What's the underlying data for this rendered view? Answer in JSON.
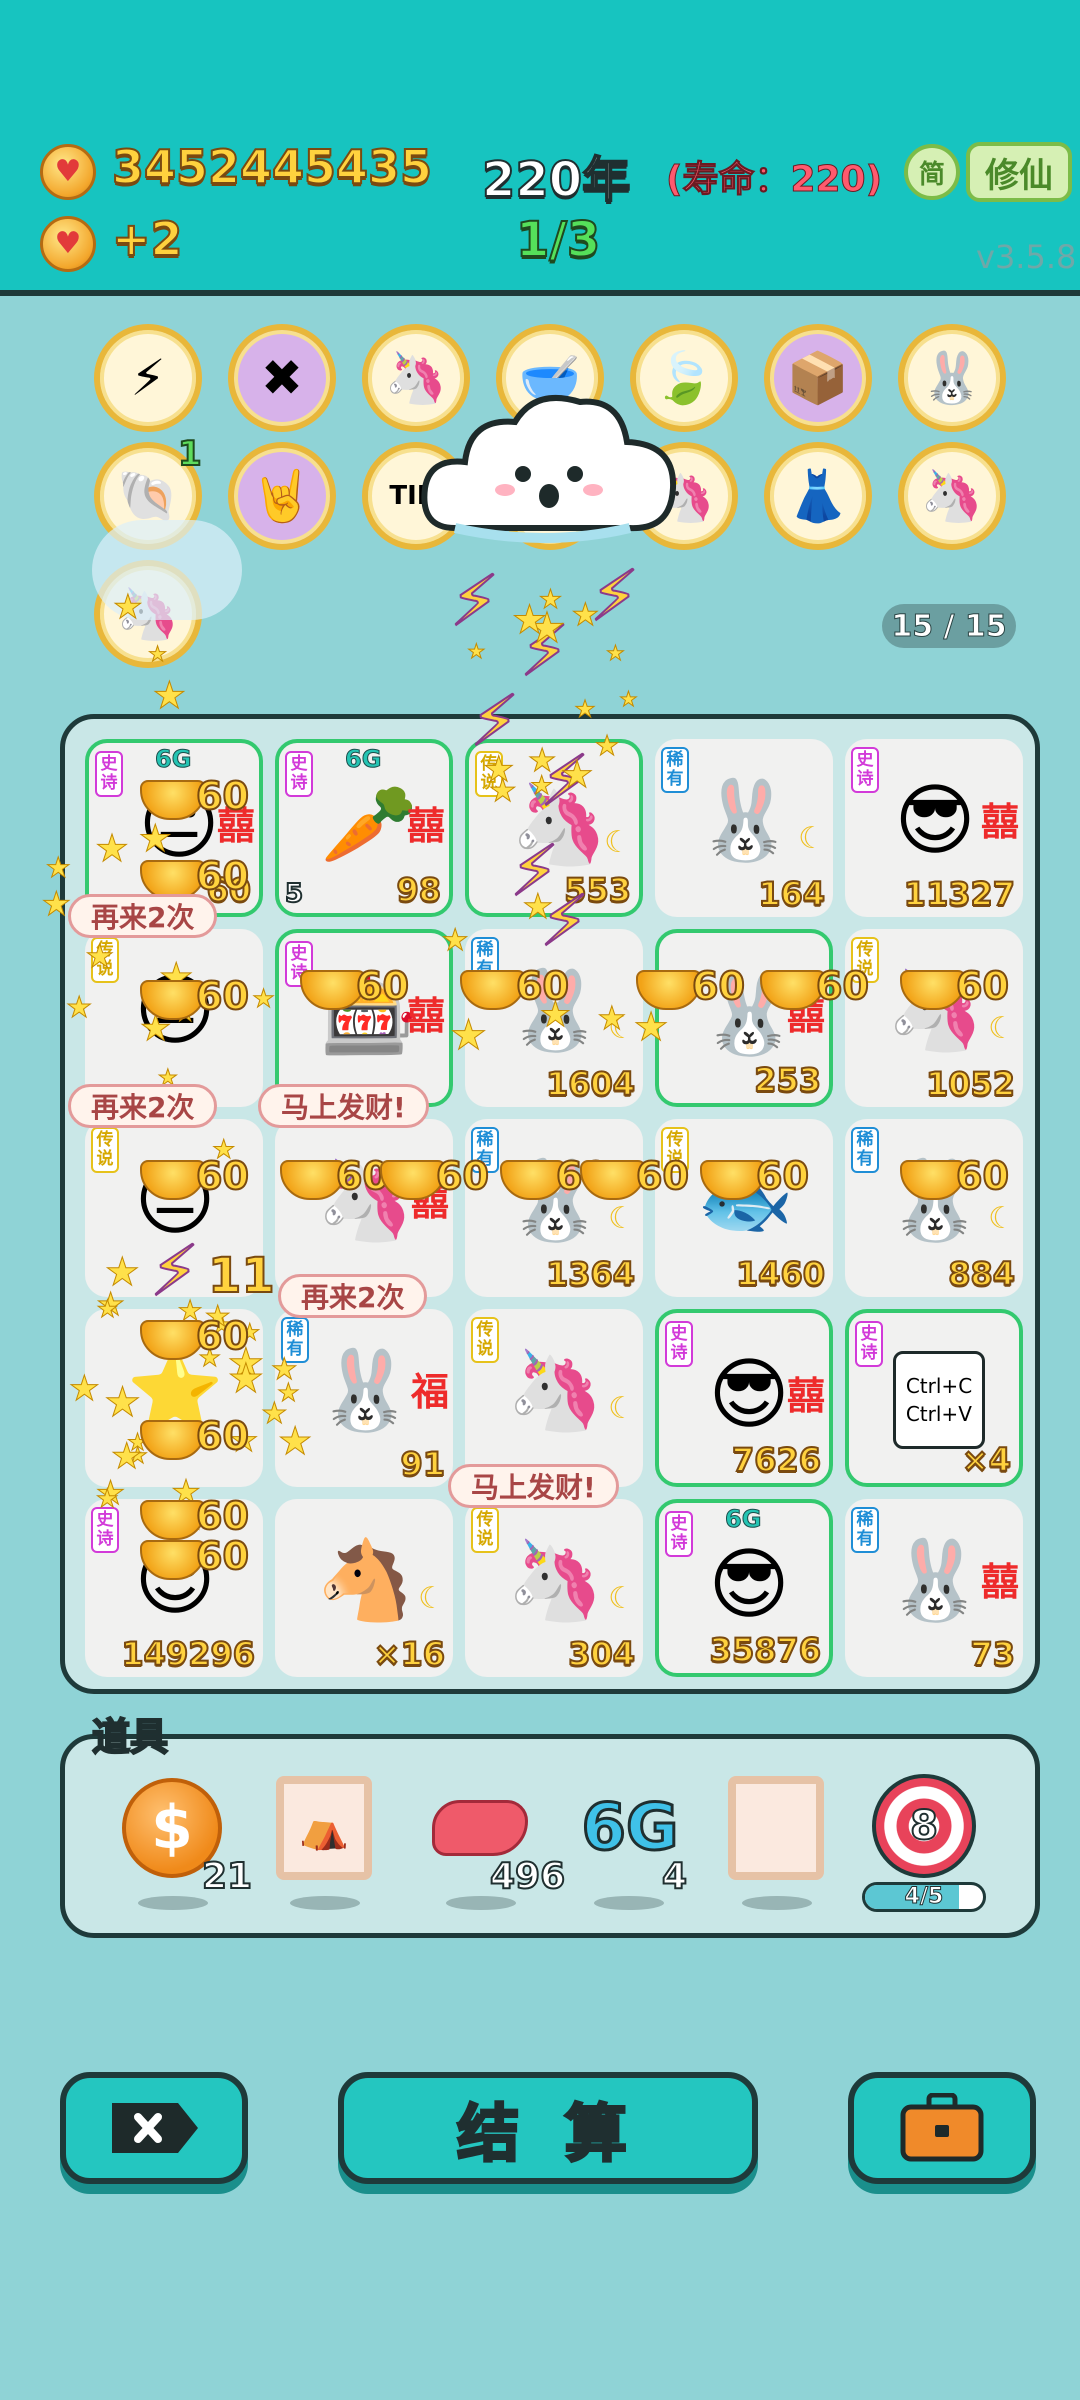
{
  "header": {
    "coins": "3452445435",
    "year": "220年",
    "lifespan": "(寿命：220)",
    "income": "+2",
    "round": "1/3",
    "simplified_label": "简",
    "cultivate_label": "修仙",
    "version": "v3.5.8"
  },
  "relics": {
    "count_badge": "1",
    "page_count": "15 / 15",
    "row1": [
      {
        "icon": "lightning-icon",
        "glyph": "⚡"
      },
      {
        "icon": "math-symbols-icon",
        "glyph": "✖"
      },
      {
        "icon": "unicorn-icon",
        "glyph": "🦄"
      },
      {
        "icon": "bowl-icon",
        "glyph": "🥣"
      },
      {
        "icon": "leaf-icon",
        "glyph": "🍃"
      },
      {
        "icon": "tissue-box-icon",
        "glyph": "📦"
      },
      {
        "icon": "rabbit-icon",
        "glyph": "🐰"
      }
    ],
    "row2": [
      {
        "icon": "shell-icon",
        "glyph": "🐚"
      },
      {
        "icon": "rock-hand-icon",
        "glyph": "🤘"
      },
      {
        "icon": "tim-card-icon",
        "glyph": "TIM"
      },
      {
        "icon": "cloud-icon",
        "glyph": "☁"
      },
      {
        "icon": "unicorn-icon",
        "glyph": "🦄"
      },
      {
        "icon": "skirt-icon",
        "glyph": "👗"
      },
      {
        "icon": "unicorn-icon",
        "glyph": "🦄"
      }
    ]
  },
  "board": {
    "cells": [
      {
        "rarity": "史诗",
        "rarity_color": "purple",
        "g6": "6G",
        "icon": "face-icon",
        "glyph": "😐",
        "xi": "囍",
        "value": "60",
        "left": "",
        "border": "green"
      },
      {
        "rarity": "史诗",
        "rarity_color": "purple",
        "g6": "6G",
        "icon": "carrot-icon",
        "glyph": "🥕",
        "xi": "囍",
        "value": "98",
        "left": "5",
        "border": "green"
      },
      {
        "rarity": "传说",
        "rarity_color": "yellow",
        "g6": "",
        "icon": "unicorn-icon",
        "glyph": "🦄",
        "xi": "",
        "value": "553",
        "left": "",
        "border": "green"
      },
      {
        "rarity": "稀有",
        "rarity_color": "blue",
        "g6": "",
        "icon": "rabbit-icon",
        "glyph": "🐰",
        "xi": "",
        "value": "164",
        "left": "",
        "border": ""
      },
      {
        "rarity": "史诗",
        "rarity_color": "purple",
        "g6": "",
        "icon": "cool-guy-icon",
        "glyph": "😎",
        "xi": "囍",
        "value": "11327",
        "left": "",
        "border": ""
      },
      {
        "rarity": "传说",
        "rarity_color": "yellow",
        "g6": "",
        "icon": "face-icon",
        "glyph": "😐",
        "xi": "",
        "value": "",
        "left": "",
        "border": ""
      },
      {
        "rarity": "史诗",
        "rarity_color": "purple",
        "g6": "",
        "icon": "vending-machine-icon",
        "glyph": "🎰",
        "xi": "囍",
        "value": "",
        "left": "",
        "border": "green"
      },
      {
        "rarity": "稀有",
        "rarity_color": "blue",
        "g6": "",
        "icon": "rabbit-icon",
        "glyph": "🐰",
        "xi": "",
        "value": "1604",
        "left": "",
        "border": ""
      },
      {
        "rarity": "",
        "rarity_color": "",
        "g6": "",
        "icon": "rabbit-icon",
        "glyph": "🐰",
        "xi": "囍",
        "value": "253",
        "left": "",
        "border": "green"
      },
      {
        "rarity": "传说",
        "rarity_color": "yellow",
        "g6": "",
        "icon": "unicorn-icon",
        "glyph": "🦄",
        "xi": "",
        "value": "1052",
        "left": "",
        "border": ""
      },
      {
        "rarity": "传说",
        "rarity_color": "yellow",
        "g6": "",
        "icon": "face-icon",
        "glyph": "😐",
        "xi": "",
        "value": "",
        "left": "",
        "border": ""
      },
      {
        "rarity": "",
        "rarity_color": "",
        "g6": "",
        "icon": "unicorn-icon",
        "glyph": "🦄",
        "xi": "囍",
        "value": "",
        "left": "",
        "border": ""
      },
      {
        "rarity": "稀有",
        "rarity_color": "blue",
        "g6": "",
        "icon": "rabbit-icon",
        "glyph": "🐰",
        "xi": "",
        "value": "1364",
        "left": "",
        "border": ""
      },
      {
        "rarity": "传说",
        "rarity_color": "yellow",
        "g6": "",
        "icon": "koi-fish-icon",
        "glyph": "🐟",
        "xi": "",
        "value": "1460",
        "left": "",
        "border": ""
      },
      {
        "rarity": "稀有",
        "rarity_color": "blue",
        "g6": "",
        "icon": "rabbit-icon",
        "glyph": "🐰",
        "xi": "",
        "value": "884",
        "left": "",
        "border": ""
      },
      {
        "rarity": "",
        "rarity_color": "",
        "g6": "",
        "icon": "star-pile-icon",
        "glyph": "⭐",
        "xi": "",
        "value": "",
        "left": "",
        "border": ""
      },
      {
        "rarity": "稀有",
        "rarity_color": "blue",
        "g6": "",
        "icon": "rabbit-icon",
        "glyph": "🐰",
        "xi": "福",
        "value": "91",
        "left": "",
        "border": ""
      },
      {
        "rarity": "传说",
        "rarity_color": "yellow",
        "g6": "",
        "icon": "unicorn-icon",
        "glyph": "🦄",
        "xi": "",
        "value": "",
        "left": "",
        "border": ""
      },
      {
        "rarity": "史诗",
        "rarity_color": "purple",
        "g6": "",
        "icon": "cool-guy-icon",
        "glyph": "😎",
        "xi": "囍",
        "value": "7626",
        "left": "",
        "border": "green"
      },
      {
        "rarity": "史诗",
        "rarity_color": "purple",
        "g6": "",
        "icon": "copy-paste-icon",
        "glyph": "Ctrl+C\nCtrl+V",
        "xi": "",
        "value": "×4",
        "left": "",
        "border": "green"
      },
      {
        "rarity": "史诗",
        "rarity_color": "purple",
        "g6": "",
        "icon": "cool-guy-icon",
        "glyph": "😎",
        "xi": "",
        "value": "149296",
        "left": "",
        "border": ""
      },
      {
        "rarity": "",
        "rarity_color": "",
        "g6": "",
        "icon": "horse-icon",
        "glyph": "🐴",
        "xi": "",
        "value": "×16",
        "left": "",
        "border": ""
      },
      {
        "rarity": "传说",
        "rarity_color": "yellow",
        "g6": "",
        "icon": "unicorn-icon",
        "glyph": "🦄",
        "xi": "",
        "value": "304",
        "left": "",
        "border": ""
      },
      {
        "rarity": "史诗",
        "rarity_color": "purple",
        "g6": "6G",
        "icon": "cool-guy-icon",
        "glyph": "😎",
        "xi": "",
        "value": "35876",
        "left": "",
        "border": "green"
      },
      {
        "rarity": "稀有",
        "rarity_color": "blue",
        "g6": "",
        "icon": "rabbit-icon",
        "glyph": "🐰",
        "xi": "囍",
        "value": "73",
        "left": "",
        "border": ""
      }
    ],
    "bubbles": [
      "再来2次",
      "再来2次",
      "马上发财!",
      "再来2次",
      "马上发财!"
    ],
    "ingot_value": "60",
    "overlay_value": "11"
  },
  "items": {
    "label": "道具",
    "list": [
      {
        "icon": "dollar-coin-icon",
        "count": "21"
      },
      {
        "icon": "framed-tent-icon",
        "count": ""
      },
      {
        "icon": "liver-icon",
        "count": "496"
      },
      {
        "icon": "6g-logo-icon",
        "text": "6G",
        "count": "4"
      },
      {
        "icon": "empty-frame-icon",
        "count": ""
      },
      {
        "icon": "target-icon",
        "text": "8",
        "count": ""
      }
    ],
    "target_progress_text": "4/5",
    "target_progress": 0.8
  },
  "buttons": {
    "settle_label": "结 算"
  },
  "colors": {
    "header_bg": "#17c4c0",
    "page_bg": "#8fd3d6",
    "accent_gold": "#ffd23e",
    "board_border": "#1e3a3a"
  }
}
